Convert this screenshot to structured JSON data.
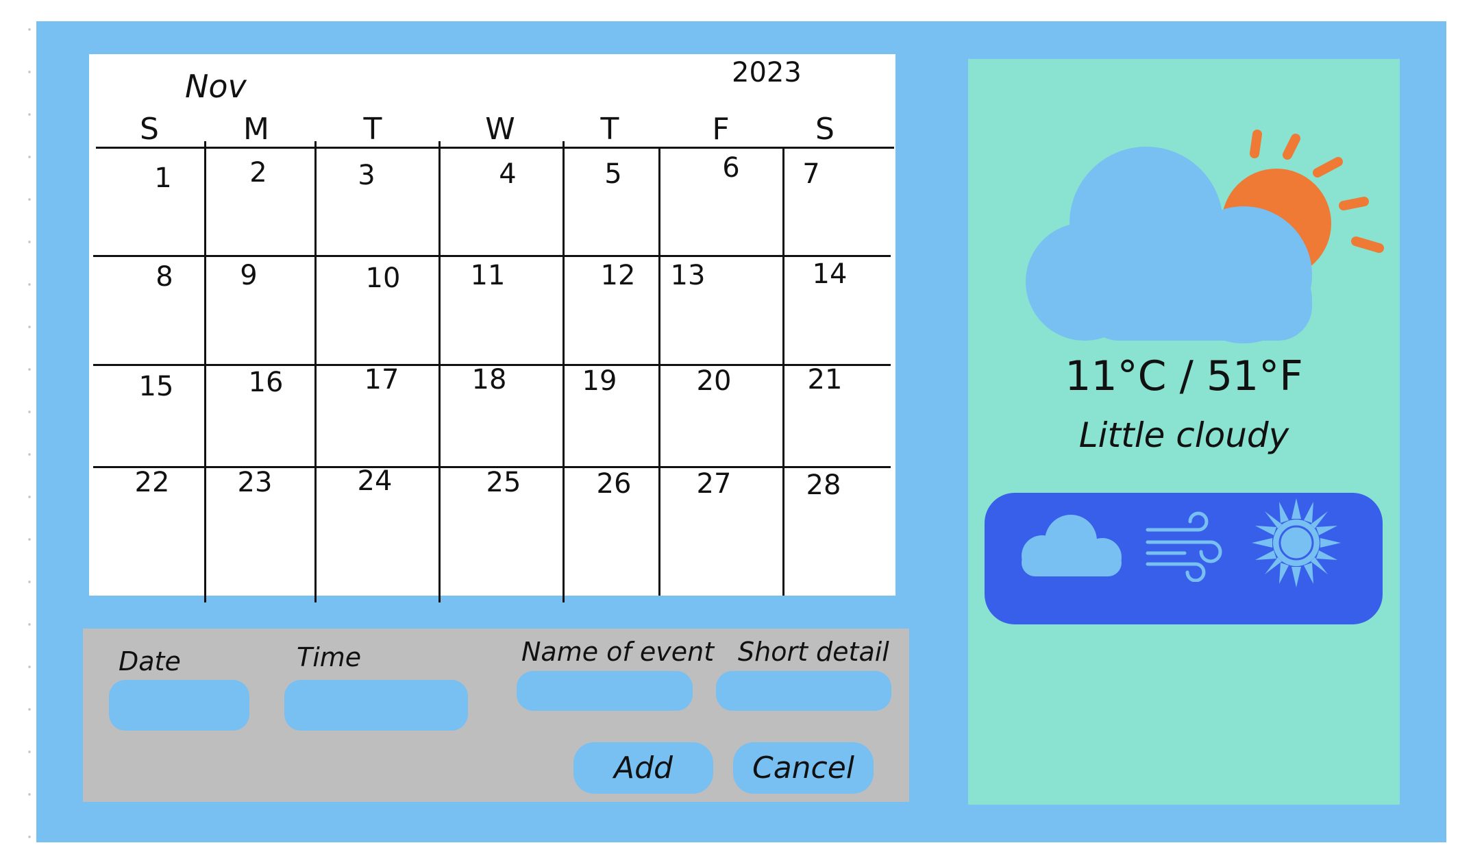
{
  "calendar": {
    "month": "Nov",
    "year": "2023",
    "weekdays": [
      "S",
      "M",
      "T",
      "W",
      "T",
      "F",
      "S"
    ],
    "weeks": [
      [
        "1",
        "2",
        "3",
        "4",
        "5",
        "6",
        "7"
      ],
      [
        "8",
        "9",
        "10",
        "11",
        "12",
        "13",
        "14"
      ],
      [
        "15",
        "16",
        "17",
        "18",
        "19",
        "20",
        "21"
      ],
      [
        "22",
        "23",
        "24",
        "25",
        "26",
        "27",
        "28"
      ]
    ]
  },
  "event_form": {
    "date_label": "Date",
    "time_label": "Time",
    "name_label": "Name of event",
    "detail_label": "Short detail",
    "date_value": "",
    "time_value": "",
    "name_value": "",
    "detail_value": "",
    "add_label": "Add",
    "cancel_label": "Cancel"
  },
  "weather": {
    "main_icon": "partly-cloudy-icon",
    "temperature": "11°C / 51°F",
    "condition": "Little cloudy",
    "forecast_icons": [
      "cloud-icon",
      "wind-icon",
      "sun-icon"
    ]
  },
  "colors": {
    "frame": "#78bff2",
    "form_panel": "#bebebe",
    "weather_panel": "#8ae2d0",
    "forecast_bar": "#385fe9",
    "sun": "#ee7a35"
  }
}
